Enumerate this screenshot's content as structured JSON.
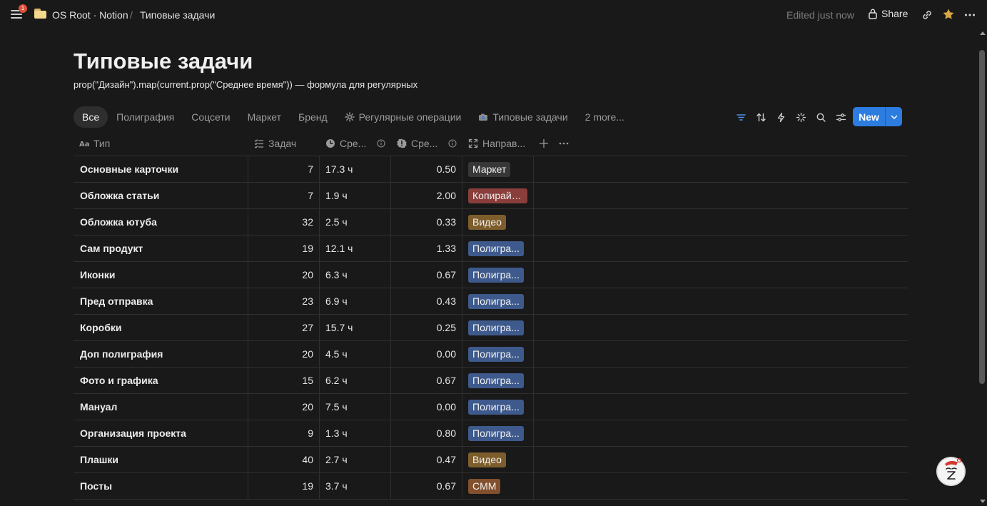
{
  "topbar": {
    "notification_count": "1",
    "crumb_workspace": "OS Root · Notion",
    "crumb_separator": "/",
    "crumb_page": "Типовые задачи",
    "edited_label": "Edited just now",
    "share_label": "Share",
    "icons": [
      "menu-icon",
      "folder-icon",
      "lock-icon",
      "link-icon",
      "star-icon",
      "more-icon"
    ],
    "star_color": "#d8a544"
  },
  "page": {
    "title": "Типовые задачи",
    "description": "prop(\"Дизайн\").map(current.prop(\"Среднее время\"))  — формула для  регулярных"
  },
  "tabs": [
    {
      "label": "Все",
      "active": true
    },
    {
      "label": "Полиграфия"
    },
    {
      "label": "Соцсети"
    },
    {
      "label": "Маркет"
    },
    {
      "label": "Бренд"
    },
    {
      "label": "Регулярные операции",
      "icon": "gear-icon"
    },
    {
      "label": "Типовые задачи",
      "icon": "camera-icon"
    },
    {
      "label": "2 more..."
    }
  ],
  "toolbar": {
    "icons": [
      "filter-icon",
      "sort-icon",
      "lightning-icon",
      "sparkle-icon",
      "search-icon",
      "settings-icon"
    ],
    "new_label": "New",
    "accent": "#2d7ce0"
  },
  "columns": {
    "name": "Тип",
    "count": "Задач",
    "avg": "Сре...",
    "ratio": "Сре...",
    "dir": "Направ..."
  },
  "tag_colors": {
    "Маркет": "#373737",
    "Копирайт...": "#8a3e3b",
    "Видео": "#7d5d2c",
    "Полигра...": "#3e5a8c",
    "CMM": "#82502d"
  },
  "rows": [
    {
      "name": "Основные карточки",
      "count": "7",
      "avg": "17.3 ч",
      "ratio": "0.50",
      "tag": "Маркет"
    },
    {
      "name": "Обложка статьи",
      "count": "7",
      "avg": "1.9 ч",
      "ratio": "2.00",
      "tag": "Копирайт..."
    },
    {
      "name": "Обложка ютуба",
      "count": "32",
      "avg": "2.5 ч",
      "ratio": "0.33",
      "tag": "Видео"
    },
    {
      "name": "Сам продукт",
      "count": "19",
      "avg": "12.1 ч",
      "ratio": "1.33",
      "tag": "Полигра..."
    },
    {
      "name": "Иконки",
      "count": "20",
      "avg": "6.3 ч",
      "ratio": "0.67",
      "tag": "Полигра..."
    },
    {
      "name": "Пред отправка",
      "count": "23",
      "avg": "6.9 ч",
      "ratio": "0.43",
      "tag": "Полигра..."
    },
    {
      "name": "Коробки",
      "count": "27",
      "avg": "15.7 ч",
      "ratio": "0.25",
      "tag": "Полигра..."
    },
    {
      "name": "Доп полиграфия",
      "count": "20",
      "avg": "4.5 ч",
      "ratio": "0.00",
      "tag": "Полигра..."
    },
    {
      "name": "Фото и графика",
      "count": "15",
      "avg": "6.2 ч",
      "ratio": "0.67",
      "tag": "Полигра..."
    },
    {
      "name": "Мануал",
      "count": "20",
      "avg": "7.5 ч",
      "ratio": "0.00",
      "tag": "Полигра..."
    },
    {
      "name": "Организация проекта",
      "count": "9",
      "avg": "1.3 ч",
      "ratio": "0.80",
      "tag": "Полигра..."
    },
    {
      "name": "Плашки",
      "count": "40",
      "avg": "2.7 ч",
      "ratio": "0.47",
      "tag": "Видео"
    },
    {
      "name": "Посты",
      "count": "19",
      "avg": "3.7 ч",
      "ratio": "0.67",
      "tag": "CMM"
    }
  ]
}
